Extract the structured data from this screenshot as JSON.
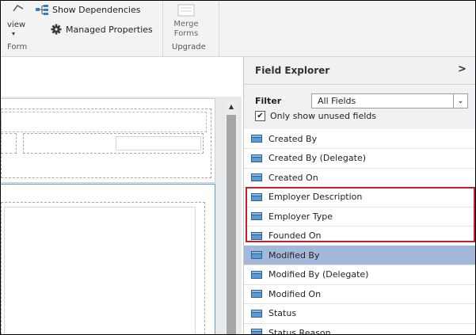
{
  "ribbon": {
    "preview": {
      "label": "view",
      "arrow": "▾"
    },
    "show_dependencies": "Show Dependencies",
    "managed_properties": "Managed Properties",
    "form_group": "Form",
    "merge_forms": "Merge Forms",
    "upgrade_group": "Upgrade"
  },
  "field_explorer": {
    "title": "Field Explorer",
    "collapse_glyph": ">",
    "filter": {
      "label": "Filter",
      "value": "All Fields",
      "arrow": "⌄"
    },
    "only_unused": {
      "label": "Only show unused fields",
      "checked": true
    },
    "items": [
      {
        "label": "Created By"
      },
      {
        "label": "Created By (Delegate)"
      },
      {
        "label": "Created On"
      },
      {
        "label": "Employer Description"
      },
      {
        "label": "Employer Type"
      },
      {
        "label": "Founded On"
      },
      {
        "label": "Modified By",
        "selected": true
      },
      {
        "label": "Modified By (Delegate)"
      },
      {
        "label": "Modified On"
      },
      {
        "label": "Status"
      },
      {
        "label": "Status Reason"
      }
    ]
  },
  "canvas": {
    "scroll_up": "▲"
  },
  "colors": {
    "highlight": "#c2202c",
    "selected_row": "#a4b9d9",
    "section_border": "#5aa0d3",
    "field_icon": "#5b9bd5"
  }
}
